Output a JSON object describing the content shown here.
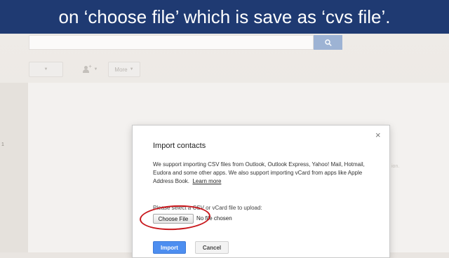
{
  "banner": {
    "text": "on ‘choose file’ which is save as ‘cvs file’."
  },
  "background": {
    "side_mark": "1",
    "toolbar": {
      "more_label": "More"
    },
    "right_hint": "ion."
  },
  "dialog": {
    "title": "Import contacts",
    "description": "We support importing CSV files from Outlook, Outlook Express, Yahoo! Mail, Hotmail, Eudora and some other apps. We also support importing vCard from apps like Apple Address Book.",
    "learn_more": "Learn more",
    "upload_label": "Please select a CSV or vCard file to upload:",
    "choose_file_button": "Choose File",
    "no_file_text": "No file chosen",
    "import_button": "Import",
    "cancel_button": "Cancel",
    "close_glyph": "×"
  },
  "colors": {
    "banner": "#1f3a72",
    "primary_button": "#4d8ef0",
    "highlight_ellipse": "#c8171c"
  }
}
